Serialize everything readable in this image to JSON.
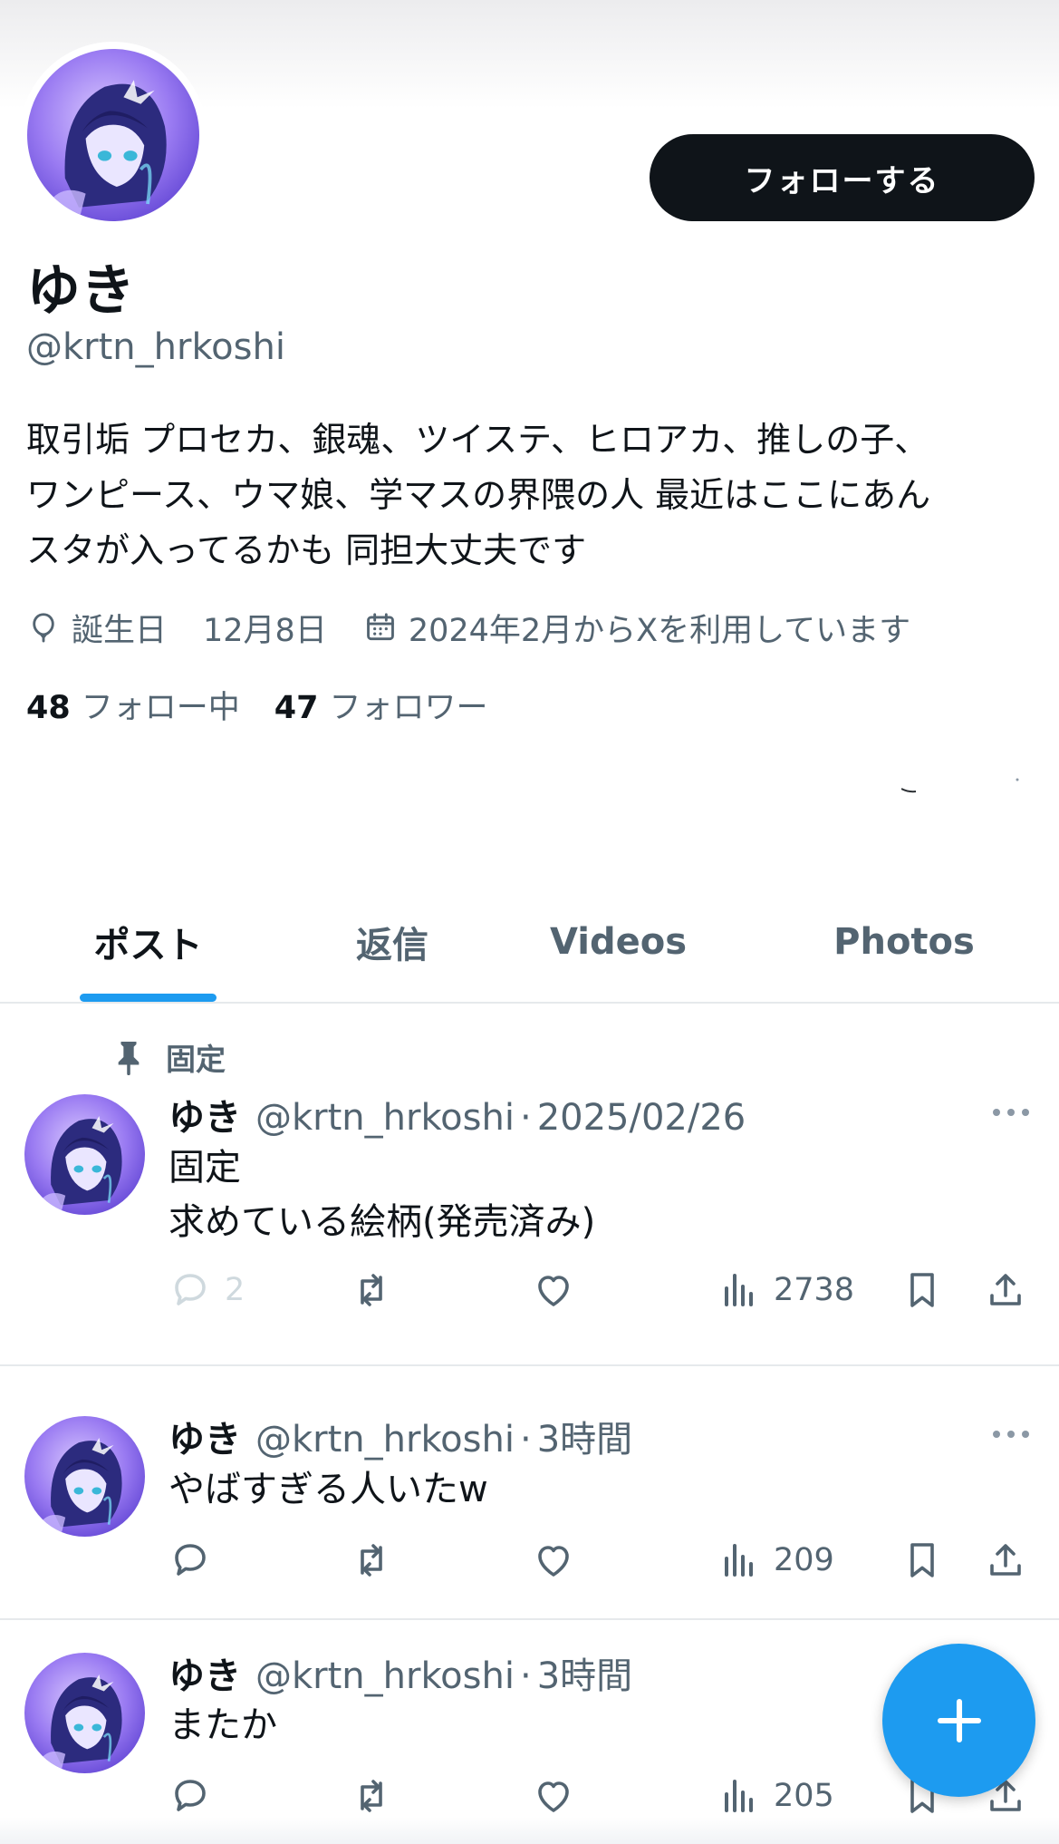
{
  "profile": {
    "display_name": "ゆき",
    "handle": "@krtn_hrkoshi",
    "follow_label": "フォローする",
    "bio": "取引垢 プロセカ、銀魂、ツイステ、ヒロアカ、推しの子、\nワンピース、ウマ娘、学マスの界隈の人 最近はここにあん\nスタが入ってるかも 同担大丈夫です",
    "birthday_label": "誕生日",
    "birthday_value": "12月8日",
    "joined": "2024年2月からXを利用しています",
    "following_count": "48",
    "following_label": "フォロー中",
    "followers_count": "47",
    "followers_label": "フォロワー",
    "avatar_icon": "avatar-anime-girl-icon"
  },
  "tabs": [
    {
      "label": "ポスト",
      "active": true
    },
    {
      "label": "返信",
      "active": false
    },
    {
      "label": "Videos",
      "active": false
    },
    {
      "label": "Photos",
      "active": false
    }
  ],
  "posts": [
    {
      "pinned_label": "固定",
      "name": "ゆき",
      "handle": "@krtn_hrkoshi",
      "separator": "·",
      "time": "2025/02/26",
      "text": "固定\n求めている絵柄(発売済み)",
      "replies": "2",
      "views": "2738"
    },
    {
      "name": "ゆき",
      "handle": "@krtn_hrkoshi",
      "separator": "·",
      "time": "3時間",
      "text": "やばすぎる人いたw",
      "replies": "",
      "views": "209"
    },
    {
      "name": "ゆき",
      "handle": "@krtn_hrkoshi",
      "separator": "·",
      "time": "3時間",
      "text": "またか",
      "replies": "",
      "views": "205"
    }
  ],
  "colors": {
    "accent": "#1d9bf0",
    "text_primary": "#0f1419",
    "text_secondary": "#536471",
    "follow_button_bg": "#0f1419"
  },
  "icons": {
    "compose": "plus-icon",
    "reply": "reply-icon",
    "repost": "repost-icon",
    "like": "heart-icon",
    "views": "views-chart-icon",
    "bookmark": "bookmark-icon",
    "share": "share-icon",
    "pin": "pin-icon",
    "birthday": "balloon-icon",
    "calendar": "calendar-icon",
    "more": "more-icon"
  }
}
